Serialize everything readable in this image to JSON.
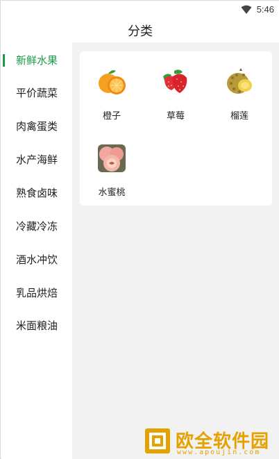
{
  "status_bar": {
    "time": "5:46"
  },
  "header": {
    "title": "分类"
  },
  "sidebar": {
    "active_index": 0,
    "items": [
      {
        "label": "新鲜水果"
      },
      {
        "label": "平价蔬菜"
      },
      {
        "label": "肉禽蛋类"
      },
      {
        "label": "水产海鲜"
      },
      {
        "label": "熟食卤味"
      },
      {
        "label": "冷藏冷冻"
      },
      {
        "label": "酒水冲饮"
      },
      {
        "label": "乳品烘焙"
      },
      {
        "label": "米面粮油"
      }
    ]
  },
  "products": [
    {
      "name": "橙子",
      "icon": "orange-icon"
    },
    {
      "name": "草莓",
      "icon": "strawberry-icon"
    },
    {
      "name": "榴莲",
      "icon": "durian-icon"
    },
    {
      "name": "水蜜桃",
      "icon": "peach-icon"
    }
  ],
  "watermark": {
    "text": "欧全软件园",
    "url": "www.apoujin.com"
  },
  "colors": {
    "accent": "#1a9a4a",
    "content_bg": "#f2f2f2",
    "watermark": "#e5a100"
  }
}
